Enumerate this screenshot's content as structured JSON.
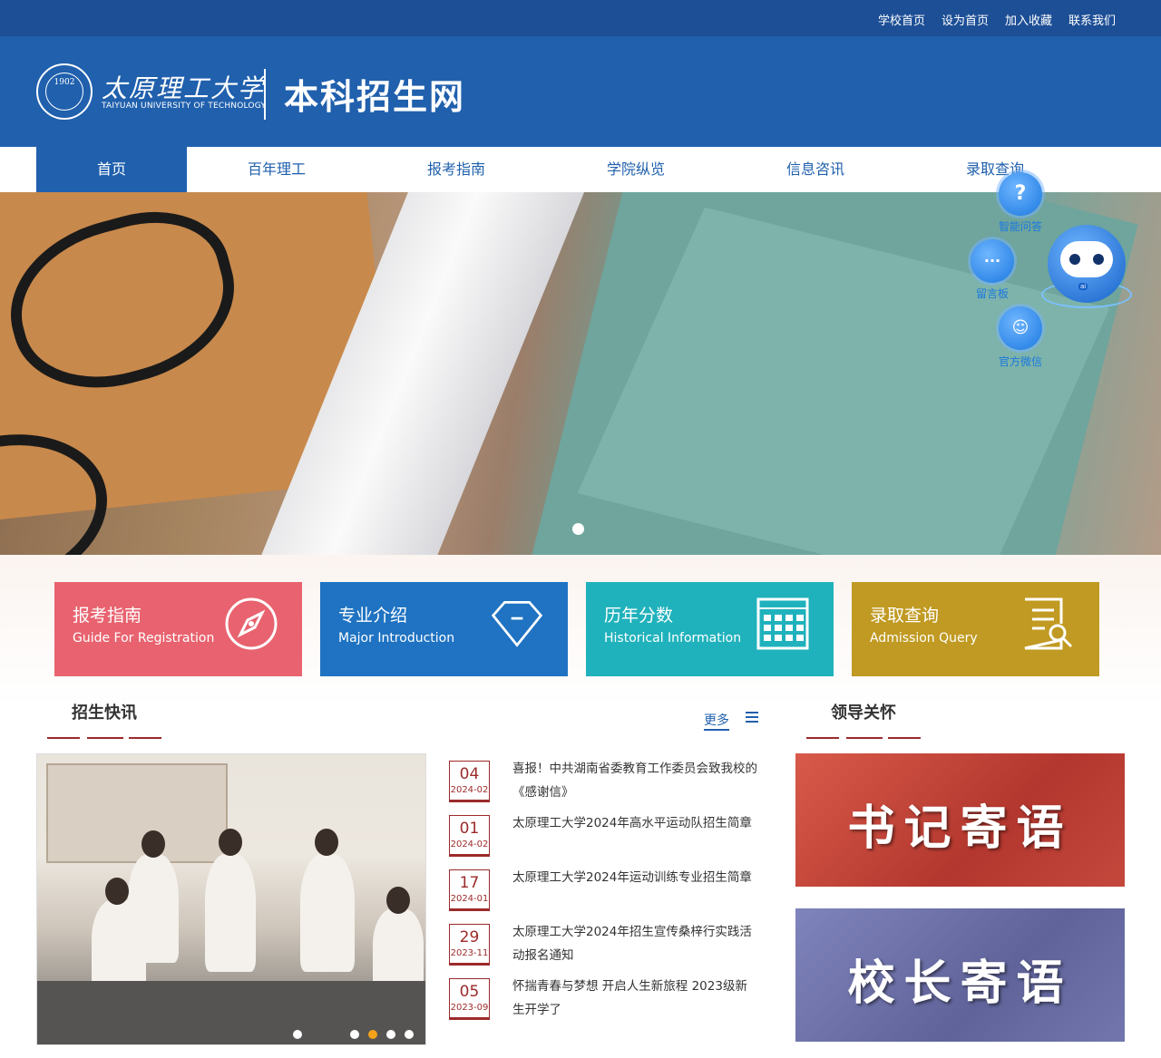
{
  "topbar": {
    "links": [
      "学校首页",
      "设为首页",
      "加入收藏",
      "联系我们"
    ]
  },
  "header": {
    "logo_year": "1902",
    "university_cn": "太原理工大学",
    "university_en": "TAIYUAN UNIVERSITY OF TECHNOLOGY",
    "site_title": "本科招生网"
  },
  "nav": {
    "items": [
      "首页",
      "百年理工",
      "报考指南",
      "学院纵览",
      "信息咨讯",
      "录取查询"
    ]
  },
  "floating": {
    "qa_label": "智能问答",
    "board_label": "留言板",
    "wechat_label": "官方微信",
    "robot_badge": "ai"
  },
  "tiles": [
    {
      "cn": "报考指南",
      "en": "Guide For Registration",
      "color": "#e8636f",
      "icon": "compass-icon"
    },
    {
      "cn": "专业介绍",
      "en": "Major Introduction",
      "color": "#1f73c2",
      "icon": "diamond-icon"
    },
    {
      "cn": "历年分数",
      "en": "Historical Information",
      "color": "#20b2bc",
      "icon": "calendar-icon"
    },
    {
      "cn": "录取查询",
      "en": "Admission Query",
      "color": "#c09a22",
      "icon": "document-search-icon"
    }
  ],
  "news": {
    "title": "招生快讯",
    "more": "更多",
    "items": [
      {
        "day": "04",
        "ym": "2024-02",
        "text": "喜报！中共湖南省委教育工作委员会致我校的《感谢信》"
      },
      {
        "day": "01",
        "ym": "2024-02",
        "text": "太原理工大学2024年高水平运动队招生简章"
      },
      {
        "day": "17",
        "ym": "2024-01",
        "text": "太原理工大学2024年运动训练专业招生简章"
      },
      {
        "day": "29",
        "ym": "2023-11",
        "text": "太原理工大学2024年招生宣传桑梓行实践活动报名通知"
      },
      {
        "day": "05",
        "ym": "2023-09",
        "text": "怀揣青春与梦想 开启人生新旅程 2023级新生开学了"
      }
    ]
  },
  "leaders": {
    "title": "领导关怀",
    "cards": [
      {
        "text": "书记寄语",
        "color": "#c24a3e"
      },
      {
        "text": "校长寄语",
        "color": "#6b6fa8"
      }
    ]
  },
  "colors": {
    "brand_blue": "#2060ad",
    "topbar_blue": "#1d4f96",
    "accent_red": "#9c2a2a"
  }
}
